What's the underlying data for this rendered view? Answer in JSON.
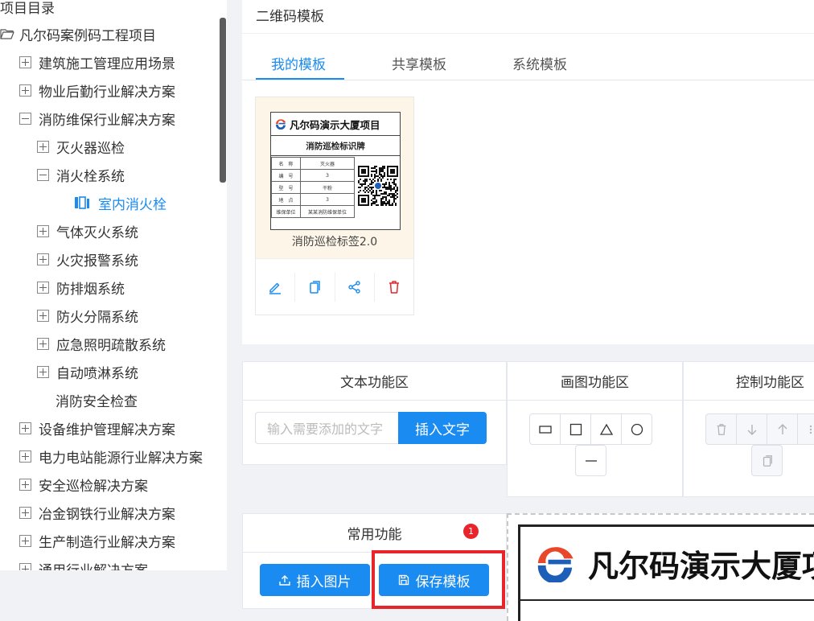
{
  "sidebar": {
    "title": "项目目录",
    "root": "凡尔码案例码工程项目",
    "items": [
      {
        "label": "建筑施工管理应用场景",
        "state": "plus",
        "level": 1
      },
      {
        "label": "物业后勤行业解决方案",
        "state": "plus",
        "level": 1
      },
      {
        "label": "消防维保行业解决方案",
        "state": "minus",
        "level": 1
      },
      {
        "label": "灭火器巡检",
        "state": "plus",
        "level": 2
      },
      {
        "label": "消火栓系统",
        "state": "minus",
        "level": 2
      },
      {
        "label": "室内消火栓",
        "state": "leaf",
        "level": 3,
        "selected": true
      },
      {
        "label": "气体灭火系统",
        "state": "plus",
        "level": 2
      },
      {
        "label": "火灾报警系统",
        "state": "plus",
        "level": 2
      },
      {
        "label": "防排烟系统",
        "state": "plus",
        "level": 2
      },
      {
        "label": "防火分隔系统",
        "state": "plus",
        "level": 2
      },
      {
        "label": "应急照明疏散系统",
        "state": "plus",
        "level": 2
      },
      {
        "label": "自动喷淋系统",
        "state": "plus",
        "level": 2
      },
      {
        "label": "消防安全检查",
        "state": "none",
        "level": 2
      },
      {
        "label": "设备维护管理解决方案",
        "state": "plus",
        "level": 1
      },
      {
        "label": "电力电站能源行业解决方案",
        "state": "plus",
        "level": 1
      },
      {
        "label": "安全巡检解决方案",
        "state": "plus",
        "level": 1
      },
      {
        "label": "冶金钢铁行业解决方案",
        "state": "plus",
        "level": 1
      },
      {
        "label": "生产制造行业解决方案",
        "state": "plus",
        "level": 1
      },
      {
        "label": "通用行业解决方案",
        "state": "plus",
        "level": 1
      }
    ]
  },
  "templates": {
    "title": "二维码模板",
    "tabs": [
      "我的模板",
      "共享模板",
      "系统模板"
    ],
    "active_tab": 0,
    "card": {
      "name": "消防巡检标签2.0",
      "thumb_header": "凡尔码演示大厦项目",
      "thumb_subtitle": "消防巡检标识牌",
      "thumb_rows": [
        [
          "名　称",
          "灭火器"
        ],
        [
          "编　号",
          "3"
        ],
        [
          "型　号",
          "干粉"
        ],
        [
          "地　点",
          "3"
        ],
        [
          "维保单位",
          "某某消防维保单位"
        ]
      ]
    }
  },
  "text_panel": {
    "title": "文本功能区",
    "placeholder": "输入需要添加的文字",
    "insert_button": "插入文字"
  },
  "draw_panel": {
    "title": "画图功能区"
  },
  "control_panel": {
    "title": "控制功能区"
  },
  "common_panel": {
    "title": "常用功能",
    "insert_image_button": "插入图片",
    "save_template_button": "保存模板",
    "badge": "1"
  },
  "canvas": {
    "title": "凡尔码演示大厦项目"
  },
  "colors": {
    "primary": "#1a8bf0",
    "danger": "#e8252b"
  }
}
